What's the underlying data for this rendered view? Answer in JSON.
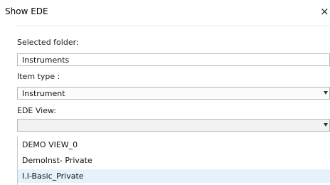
{
  "window": {
    "title": "Show EDE",
    "close_glyph": "×"
  },
  "form": {
    "selected_folder_label": "Selected folder:",
    "selected_folder_value": "Instruments",
    "item_type_label": "Item type :",
    "item_type_value": "Instrument",
    "ede_view_label": "EDE View:",
    "ede_view_value": ""
  },
  "dropdown": {
    "options": [
      {
        "label": "DEMO VIEW_0",
        "hovered": false
      },
      {
        "label": "DemoInst- Private",
        "hovered": false
      },
      {
        "label": "I.I-Basic_Private",
        "hovered": true
      }
    ]
  },
  "colors": {
    "hover_highlight": "#e5f1fb",
    "border": "#b9b9b9"
  },
  "icons": {
    "close": "close-icon",
    "dropdown_arrow": "chevron-down-icon"
  }
}
